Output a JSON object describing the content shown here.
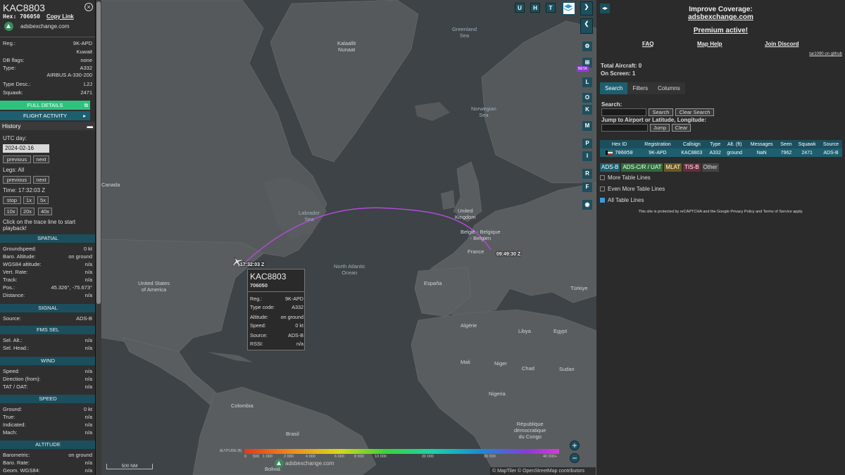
{
  "aircraft": {
    "callsign": "KAC8803",
    "hex_label": "Hex:",
    "hex": "706050",
    "copy_link": "Copy Link",
    "source_site": "adsbexchange.com",
    "details": [
      {
        "k": "Reg.:",
        "v": "9K-APD"
      },
      {
        "k": "",
        "v": "Kuwait"
      },
      {
        "k": "DB flags:",
        "v": "none"
      },
      {
        "k": "Type:",
        "v": "A332"
      },
      {
        "k": "",
        "v": "AIRBUS A-330-200"
      },
      {
        "k": "Type Desc.:",
        "v": "L2J"
      },
      {
        "k": "Squawk:",
        "v": "2471"
      }
    ],
    "full_details": "FULL DETAILS",
    "flight_activity": "FLIGHT ACTIVITY"
  },
  "history": {
    "header": "History",
    "utc_label": "UTC day:",
    "date": "2024-02-16",
    "previous": "previous",
    "next": "next",
    "legs_label": "Legs: All",
    "time_label": "Time: 17:32:03 Z",
    "speed_buttons": [
      "stop",
      "1x",
      "5x",
      "10x",
      "20x",
      "40x"
    ],
    "hint": "Click on the trace line to start playback!"
  },
  "sections": {
    "spatial": {
      "title": "SPATIAL",
      "rows": [
        {
          "k": "Groundspeed:",
          "v": "0 kt"
        },
        {
          "k": "Baro. Altitude:",
          "v": "on ground"
        },
        {
          "k": "WGS84 altitude:",
          "v": "n/a"
        },
        {
          "k": "Vert. Rate:",
          "v": "n/a"
        },
        {
          "k": "Track:",
          "v": "n/a"
        },
        {
          "k": "Pos.:",
          "v": "45.326°, -75.673°"
        },
        {
          "k": "Distance:",
          "v": "n/a"
        }
      ]
    },
    "signal": {
      "title": "SIGNAL",
      "rows": [
        {
          "k": "Source:",
          "v": "ADS-B"
        }
      ]
    },
    "fms": {
      "title": "FMS SEL",
      "rows": [
        {
          "k": "Sel. Alt.:",
          "v": "n/a"
        },
        {
          "k": "Sel. Head.:",
          "v": "n/a"
        }
      ]
    },
    "wind": {
      "title": "WIND",
      "rows": [
        {
          "k": "Speed:",
          "v": "n/a"
        },
        {
          "k": "Direction (from):",
          "v": "n/a"
        },
        {
          "k": "TAT / OAT:",
          "v": "n/a"
        }
      ]
    },
    "speed": {
      "title": "SPEED",
      "rows": [
        {
          "k": "Ground:",
          "v": "0 kt"
        },
        {
          "k": "True:",
          "v": "n/a"
        },
        {
          "k": "Indicated:",
          "v": "n/a"
        },
        {
          "k": "Mach:",
          "v": "n/a"
        }
      ]
    },
    "altitude": {
      "title": "ALTITUDE",
      "rows": [
        {
          "k": "Barometric:",
          "v": "on ground"
        },
        {
          "k": "Baro. Rate:",
          "v": "n/a"
        },
        {
          "k": "Geom. WGS84:",
          "v": "n/a"
        }
      ]
    }
  },
  "map": {
    "labels": {
      "greenland": "Greenland\nSea",
      "kalaallit": "Kalaallit\nNunaat",
      "norwegian": "Norwegian\nSea",
      "labrador": "Labrador\nSea",
      "north_atlantic": "North Atlantic\nOcean",
      "canada": "Canada",
      "usa": "United States\nof America",
      "uk": "United\nKingdom",
      "belgie": "België - Belgique\n- Belgien",
      "france": "France",
      "espana": "España",
      "algerie": "Algérie",
      "libya": "Libya",
      "egypt": "Egypt",
      "niger": "Niger",
      "mali": "Mali",
      "chad": "Chad",
      "sudan": "Sudan",
      "colombia": "Colombia",
      "brasil": "Brasil",
      "turkiye": "Türkiye",
      "rdc": "République\ndémocratique\ndu Congo",
      "nigeria": "Nigeria",
      "bolivia": "Bolivia"
    },
    "top_buttons": [
      "U",
      "H",
      "T"
    ],
    "side_buttons": [
      "L",
      "O",
      "K",
      "M",
      "P",
      "I",
      "R",
      "F"
    ],
    "beta": "BETA",
    "time_start": "17:32:03 Z",
    "time_end": "09:49:30 Z",
    "scale": "500 NM",
    "legend_title": "ALTITUDE (ft)",
    "legend_ticks": [
      "0",
      "500",
      "1 000",
      "2 000",
      "4 000",
      "6 000",
      "8 000",
      "10 000",
      "20 000",
      "30 000",
      "40 000+"
    ],
    "watermark": "adsbexchange.com",
    "attribution": "© MapTiler © OpenStreetMap contributors",
    "zoom_in": "+",
    "zoom_out": "−"
  },
  "popup": {
    "callsign": "KAC8803",
    "hex": "706050",
    "rows": [
      {
        "k": "Reg.:",
        "v": "9K-APD"
      },
      {
        "k": "Type code:",
        "v": "A332"
      },
      {
        "k": "Altitude:",
        "v": "on ground"
      },
      {
        "k": "Speed:",
        "v": "0 kt"
      },
      {
        "k": "Source:",
        "v": "ADS-B"
      },
      {
        "k": "RSSI:",
        "v": "n/a"
      }
    ]
  },
  "right": {
    "improve": "Improve Coverage:",
    "improve_link": "adsbexchange.com",
    "premium": "Premium active!",
    "faq": "FAQ",
    "map_help": "Map Help",
    "discord": "Join Discord",
    "github": "tar1090 on github",
    "total": "Total Aircraft: 0",
    "onscreen": "On Screen: 1",
    "tabs": [
      "Search",
      "Filters",
      "Columns"
    ],
    "search_label": "Search:",
    "search_btn": "Search",
    "clear_search": "Clear Search",
    "jump_label": "Jump to Airport or Latitude, Longitude:",
    "jump_btn": "Jump",
    "clear_btn": "Clear",
    "table": {
      "headers": [
        "Hex ID",
        "Registration",
        "Callsign",
        "Type",
        "Alt. (ft)",
        "Messages",
        "Seen",
        "Squawk",
        "Source"
      ],
      "rows": [
        [
          "706050",
          "9K-APD",
          "KAC8803",
          "A332",
          "ground",
          "NaN",
          "7962",
          "2471",
          "ADS-B"
        ]
      ]
    },
    "sources": [
      {
        "label": "ADS-B",
        "bg": "#1e5f6f",
        "fg": "#fff"
      },
      {
        "label": "ADS-C/R / UAT",
        "bg": "#2e6b3b",
        "fg": "#fff"
      },
      {
        "label": "MLAT",
        "bg": "#6b5a1f",
        "fg": "#fff"
      },
      {
        "label": "TIS-B",
        "bg": "#6b2b3b",
        "fg": "#fff"
      },
      {
        "label": "Other",
        "bg": "#444",
        "fg": "#ddd"
      }
    ],
    "more_lines": "More Table Lines",
    "even_more": "Even More Table Lines",
    "all_lines": "All Table Lines",
    "recaptcha": "This site is protected by reCAPTCHA and the Google Privacy Policy and Terms of Service apply."
  },
  "colors": {
    "accent": "#1d4f5e",
    "track": "#b04ad8",
    "green": "#2ec27e"
  }
}
